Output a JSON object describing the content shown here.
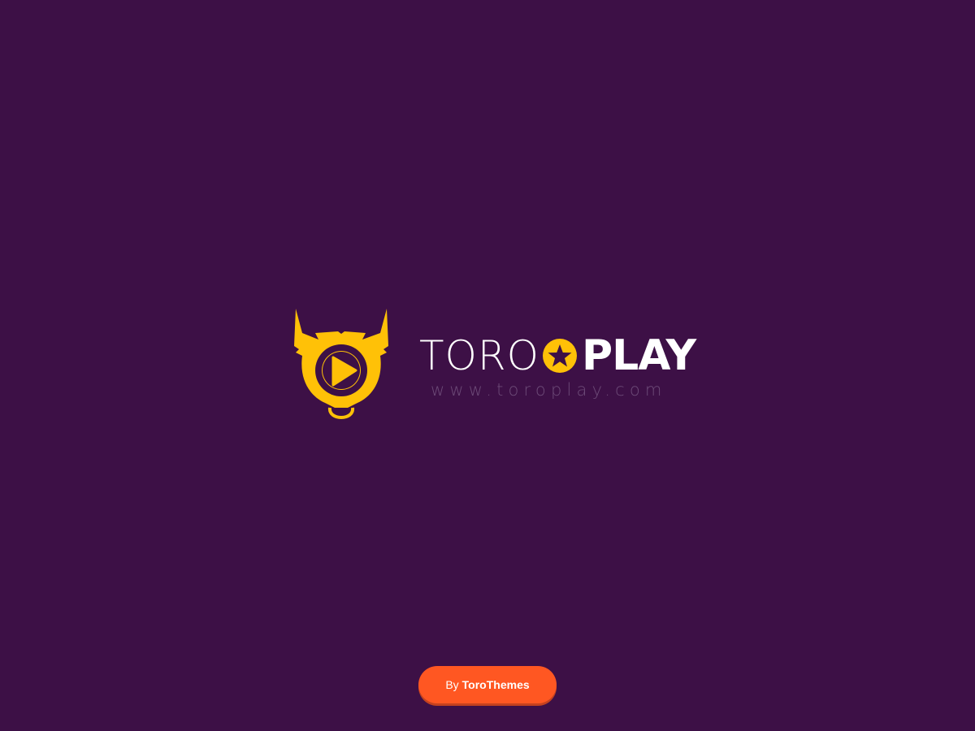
{
  "brand": {
    "name_light": "TORO",
    "name_bold": "PLAY",
    "url": "www.toroplay.com",
    "logo_icon": "bull-play-icon",
    "accent": "#ffc107"
  },
  "footer": {
    "by_label": "By",
    "author": "ToroThemes",
    "button_color": "#ff5722"
  },
  "background": "#3d1046"
}
